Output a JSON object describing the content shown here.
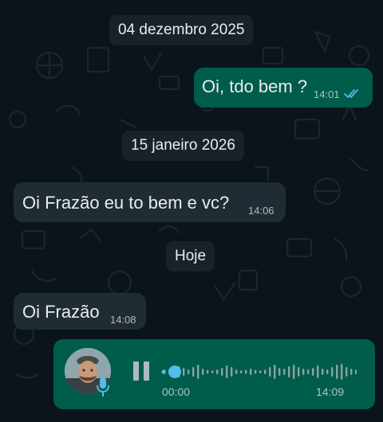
{
  "colors": {
    "background": "#0b141a",
    "bubble_outgoing": "#005c4b",
    "bubble_incoming": "#202c33",
    "date_chip": "#182229",
    "read_ticks": "#53bdeb",
    "waveform_played": "#53bdeb",
    "waveform_unplayed": "#8aa4a0"
  },
  "chat": {
    "date_1": "04 dezembro 2025",
    "date_2": "15 janeiro 2026",
    "date_3": "Hoje",
    "messages": [
      {
        "direction": "outgoing",
        "text": "Oi, tdo bem  ?",
        "time": "14:01",
        "status": "read",
        "status_icon": "double-check-icon"
      },
      {
        "direction": "incoming",
        "text": "Oi Frazão eu to bem e vc?",
        "time": "14:06"
      },
      {
        "direction": "incoming",
        "text": "Oi Frazão",
        "time": "14:08"
      }
    ],
    "voice_note": {
      "direction": "outgoing",
      "elapsed": "00:00",
      "time": "14:09",
      "progress": 0,
      "state": "paused-icon-shown",
      "avatar_icon": "avatar",
      "badge_icon": "microphone-icon",
      "control_icon": "pause-icon"
    }
  }
}
